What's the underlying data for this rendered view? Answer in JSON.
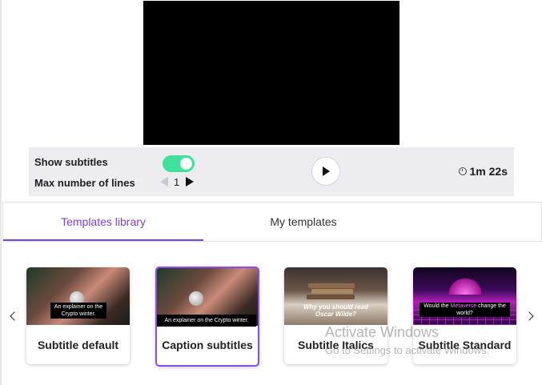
{
  "controls": {
    "show_subtitles_label": "Show subtitles",
    "show_subtitles_on": true,
    "max_lines_label": "Max number of lines",
    "max_lines_value": "1",
    "duration": "1m 22s",
    "toggle_color": "#3ee29a"
  },
  "tabs": [
    {
      "label": "Templates library",
      "active": true
    },
    {
      "label": "My templates",
      "active": false
    }
  ],
  "accent_color": "#7b3fe4",
  "templates": [
    {
      "title": "Subtitle default",
      "caption_lines": [
        "An explainer on the",
        "Crypto winter."
      ],
      "icon": "hand-coin-thumbnail"
    },
    {
      "title": "Caption subtitles",
      "caption_lines": [
        "An explainer on the Crypto winter."
      ],
      "selected": true,
      "icon": "hand-coin-thumbnail"
    },
    {
      "title": "Subtitle Italics",
      "caption_lines": [
        "Why you should read",
        "Oscar Wilde?"
      ],
      "icon": "books-thumbnail"
    },
    {
      "title": "Subtitle Standard",
      "caption_lines": [
        "Would the Metaverse change the",
        "world?"
      ],
      "highlight": "Metaverse",
      "icon": "metaverse-thumbnail"
    }
  ],
  "watermark": {
    "line1": "Activate Windows",
    "line2": "Go to Settings to activate Windows."
  }
}
